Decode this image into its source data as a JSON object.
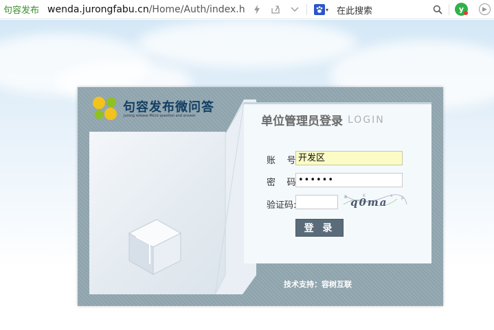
{
  "browser": {
    "site_name": "句容发布",
    "url_host": "wenda.jurongfabu.cn",
    "url_path": "/Home/Auth/index.h",
    "search_placeholder": "在此搜索",
    "search_engine_icon": "paw-icon",
    "extension_letter": "y"
  },
  "brand": {
    "name": "句容发布微问答",
    "subtitle": "Jurong release Micro question and answer"
  },
  "form": {
    "title": "单位管理员登录",
    "title_en": "LOGIN",
    "account_label": "账    号:",
    "account_value": "开发区",
    "password_label": "密    码:",
    "password_value": "••••••",
    "captcha_label": "验证码:",
    "captcha_value": "",
    "captcha_text": "q0ma",
    "login_button": "登 录"
  },
  "footer": {
    "support": "技术支持：容树互联"
  },
  "colors": {
    "brand_green": "#3a8f2e",
    "panel_stripe": "#8fa3ad",
    "button": "#5a6c7a",
    "autofill": "#fbfcc5"
  }
}
